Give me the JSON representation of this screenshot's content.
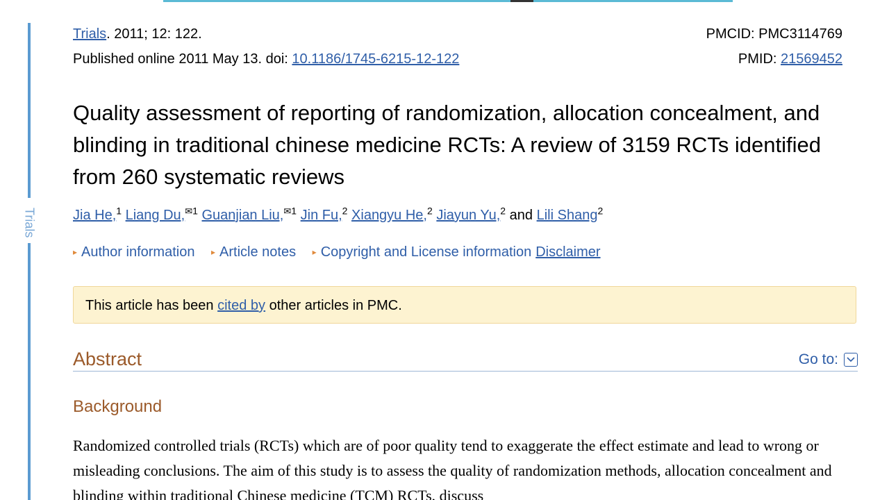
{
  "side_label": "Trials",
  "citation": {
    "journal": "Trials",
    "details": ". 2011; 12: 122."
  },
  "published": {
    "prefix": "Published online 2011 May 13. doi: ",
    "doi": "10.1186/1745-6215-12-122"
  },
  "ids": {
    "pmcid": "PMCID: PMC3114769",
    "pmid_label": "PMID: ",
    "pmid": "21569452"
  },
  "title": "Quality assessment of reporting of randomization, allocation concealment, and blinding in traditional chinese medicine RCTs: A review of 3159 RCTs identified from 260 systematic reviews",
  "authors": [
    {
      "name": "Jia He,",
      "sup": "1",
      "env": false
    },
    {
      "name": "Liang Du,",
      "sup": "1",
      "env": true
    },
    {
      "name": "Guanjian Liu,",
      "sup": "1",
      "env": true
    },
    {
      "name": "Jin Fu,",
      "sup": "2",
      "env": false
    },
    {
      "name": "Xiangyu He,",
      "sup": "2",
      "env": false
    },
    {
      "name": "Jiayun Yu,",
      "sup": "2",
      "env": false
    },
    {
      "name": "Lili Shang",
      "sup": "2",
      "env": false
    }
  ],
  "authors_and": "and",
  "env_glyph": "✉",
  "info": {
    "author_information": "Author information",
    "article_notes": "Article notes",
    "copyright": "Copyright and License information",
    "disclaimer": "Disclaimer"
  },
  "notice": {
    "before": "This article has been ",
    "link": "cited by",
    "after": " other articles in PMC."
  },
  "abstract_heading": "Abstract",
  "goto_label": "Go to:",
  "background_heading": "Background",
  "background_text": "Randomized controlled trials (RCTs) which are of poor quality tend to exaggerate the effect estimate and lead to wrong or misleading conclusions. The aim of this study is to assess the quality of randomization methods, allocation concealment and blinding within traditional Chinese medicine (TCM) RCTs, discuss",
  "colors": {
    "link": "#2f5ea8",
    "heading": "#9b5a2a",
    "notice_bg": "#fdf3d1",
    "side_bar": "#5b9bd1"
  }
}
